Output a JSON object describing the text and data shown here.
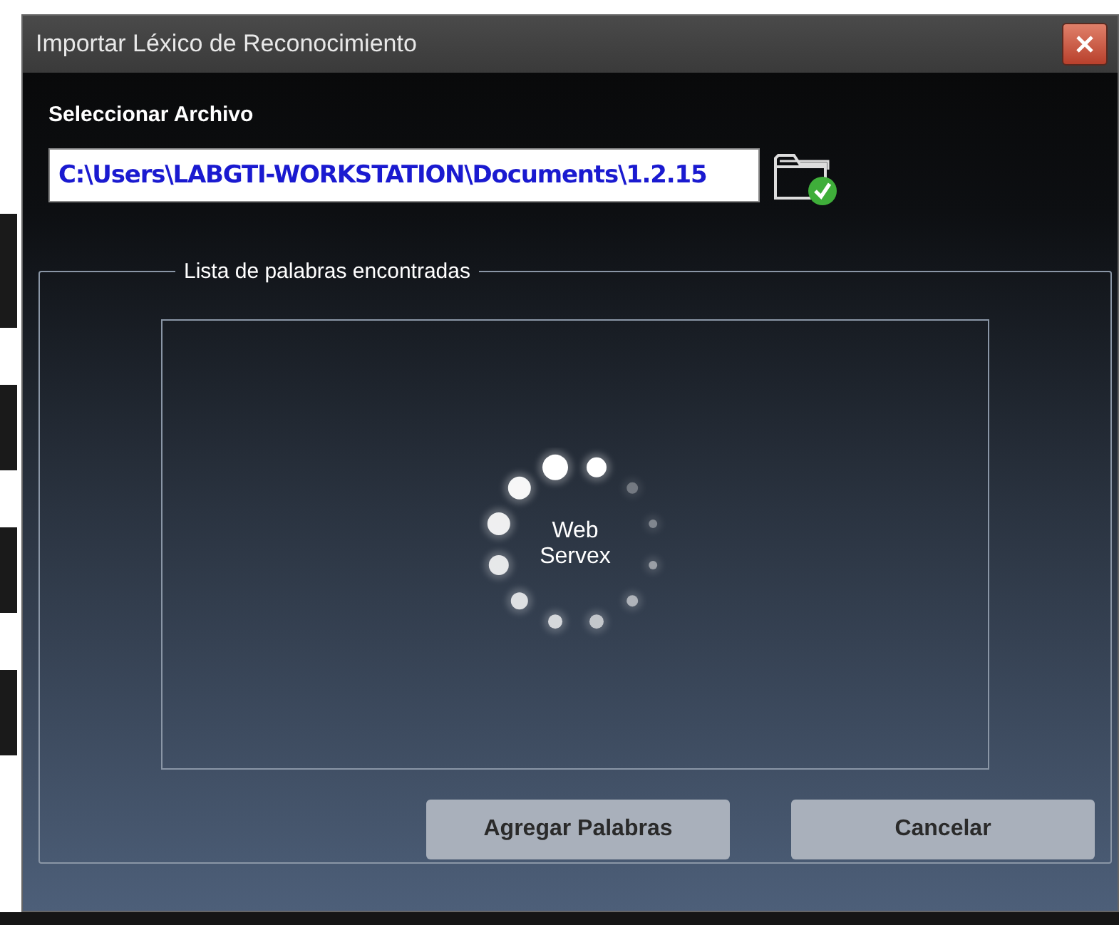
{
  "window": {
    "title": "Importar Léxico de Reconocimiento"
  },
  "file": {
    "label": "Seleccionar Archivo",
    "value": "C:\\Users\\LABGTI-WORKSTATION\\Documents\\1.2.15",
    "valid": true
  },
  "group": {
    "legend": "Lista de palabras encontradas",
    "loading": true,
    "loading_text": "Web Servex"
  },
  "buttons": [
    {
      "label": "Agregar Palabras"
    },
    {
      "label": "Cancelar"
    }
  ]
}
